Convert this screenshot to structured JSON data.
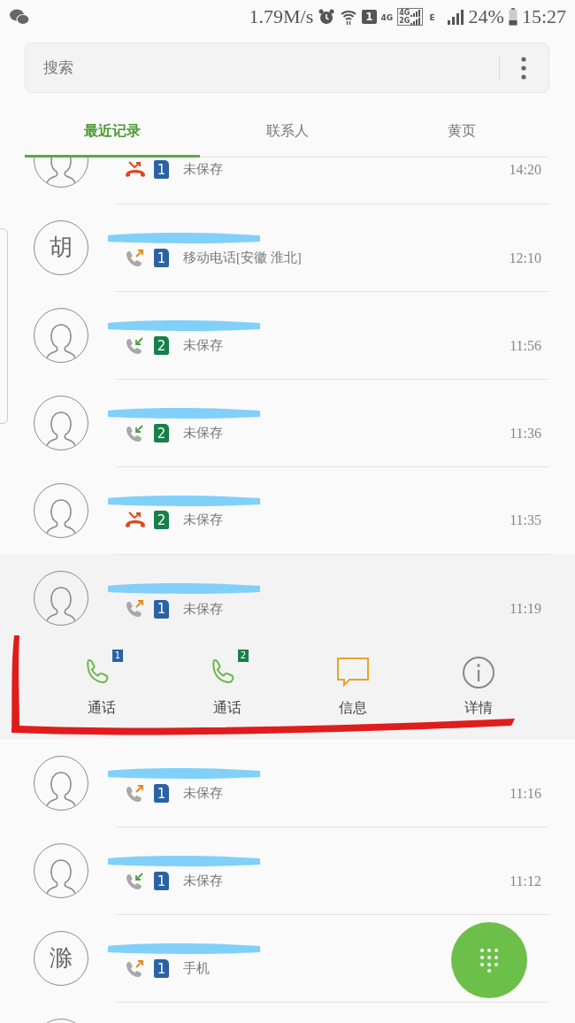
{
  "status_bar": {
    "speed": "1.79M/s",
    "sim": "1",
    "network": "4G",
    "dual_network": [
      "4G",
      "2G"
    ],
    "second_network": "E",
    "battery": "24%",
    "time": "15:27"
  },
  "search": {
    "placeholder": "搜索"
  },
  "tabs": [
    {
      "label": "最近记录",
      "selected": true
    },
    {
      "label": "联系人",
      "selected": false
    },
    {
      "label": "黄页",
      "selected": false
    }
  ],
  "calls": [
    {
      "kind": "missed",
      "sim": "1",
      "label": "未保存",
      "time": "14:20",
      "expanded": false
    },
    {
      "kind": "outgoing",
      "initial": "胡",
      "sim": "1",
      "label": "移动电话[安徽 淮北]",
      "time": "12:10",
      "expanded": false
    },
    {
      "kind": "incoming",
      "sim": "2",
      "label": "未保存",
      "time": "11:56",
      "expanded": false
    },
    {
      "kind": "incoming",
      "sim": "2",
      "label": "未保存",
      "time": "11:36",
      "expanded": false
    },
    {
      "kind": "missed",
      "sim": "2",
      "label": "未保存",
      "time": "11:35",
      "expanded": false
    },
    {
      "kind": "outgoing",
      "sim": "1",
      "label": "未保存",
      "time": "11:19",
      "expanded": true
    },
    {
      "kind": "outgoing",
      "sim": "1",
      "label": "未保存",
      "time": "11:16",
      "expanded": false
    },
    {
      "kind": "incoming",
      "sim": "1",
      "label": "未保存",
      "time": "11:12",
      "expanded": false
    },
    {
      "kind": "outgoing",
      "initial": "滁",
      "sim": "1",
      "label": "手机",
      "expanded": false
    }
  ],
  "actions": [
    {
      "kind": "call",
      "sim": "1",
      "label": "通话"
    },
    {
      "kind": "call",
      "sim": "2",
      "label": "通话"
    },
    {
      "kind": "message",
      "label": "信息"
    },
    {
      "kind": "details",
      "label": "详情"
    }
  ]
}
